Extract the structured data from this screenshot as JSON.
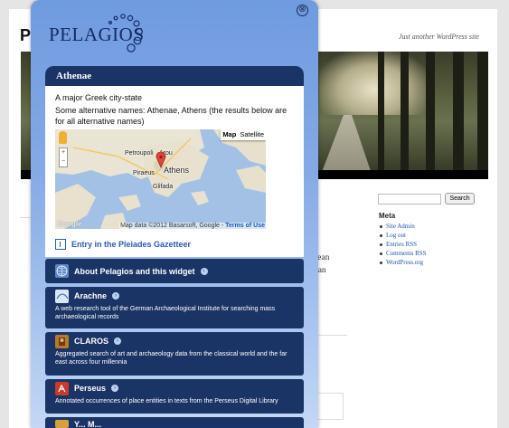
{
  "wordpress": {
    "site_title_visible": "P",
    "tagline": "Just another WordPress site",
    "body_fragments": [
      "een",
      "ly",
      "tant",
      "enaean",
      "opean"
    ],
    "search_button": "Search",
    "meta_title": "Meta",
    "meta_links": [
      "Site Admin",
      "Log out",
      "Entries RSS",
      "Comments RSS",
      "WordPress.org"
    ]
  },
  "widget": {
    "logo_text": "PELAGIOS",
    "close_label": "⊗",
    "place": {
      "name": "Athenae",
      "description": "A major Greek city-state",
      "alt_names_text": "Some alternative names: Athenae, Athens (the results below are for all alternative names)",
      "map": {
        "type_options": [
          "Map",
          "Satellite"
        ],
        "selected_type": "Map",
        "labels": [
          "Petroupoli",
          "Piraeus",
          "Athens",
          "Glifada",
          "Arou"
        ],
        "zoom_in": "+",
        "zoom_out": "−",
        "google_label": "Google",
        "attribution": "Map data ©2012 Basarsoft, Google -",
        "terms_link": "Terms of Use"
      },
      "gazetteer_link": "Entry in the Pleiades Gazetteer"
    },
    "sections": [
      {
        "title": "About Pelagios and this widget",
        "description": "",
        "icon": "globe-icon",
        "color": "#5b86c8"
      },
      {
        "title": "Arachne",
        "description": "A web research tool of the German Archaeological Institute for searching mass archaeological records",
        "icon": "arachne-icon",
        "color": "#d9e6f3"
      },
      {
        "title": "CLAROS",
        "description": "Aggregated search of art and archaeology data from the classical world and the far east across four millennia",
        "icon": "claros-icon",
        "color": "#b87a2a"
      },
      {
        "title": "Perseus",
        "description": "Annotated occurrences of place entities in texts from the Perseus Digital Library",
        "icon": "perseus-icon",
        "color": "#c83a2a"
      }
    ],
    "partial_section_title": "Y... M..."
  }
}
